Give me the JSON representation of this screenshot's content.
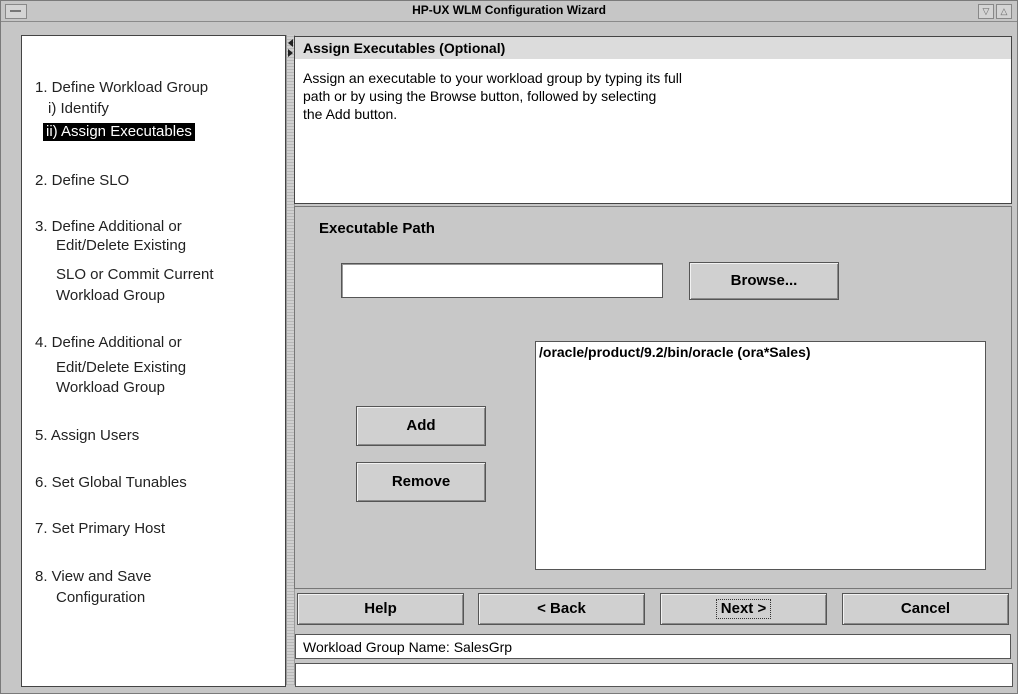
{
  "window": {
    "title": "HP-UX WLM Configuration Wizard"
  },
  "steps": [
    {
      "label": "1. Define Workload Group"
    },
    {
      "label": "2. Define SLO"
    },
    {
      "label": "3. Define Additional or"
    },
    {
      "label": "Edit/Delete Existing"
    },
    {
      "label": "SLO or Commit Current"
    },
    {
      "label": "Workload Group"
    },
    {
      "label": "4. Define Additional or"
    },
    {
      "label": "Edit/Delete Existing"
    },
    {
      "label": "Workload Group"
    },
    {
      "label": "5. Assign Users"
    },
    {
      "label": "6. Set Global Tunables"
    },
    {
      "label": "7. Set Primary Host"
    },
    {
      "label": "8. View and Save"
    },
    {
      "label": "Configuration"
    }
  ],
  "substeps": {
    "identify": "i) Identify",
    "assign": "ii) Assign Executables"
  },
  "instructions": {
    "header": "Assign Executables (Optional)",
    "lines": [
      "Assign an executable to your workload group by typing its full",
      "path or by using the Browse button, followed by selecting",
      "the Add button."
    ]
  },
  "form": {
    "path_label": "Executable Path",
    "path_value": "",
    "browse": "Browse...",
    "add": "Add",
    "remove": "Remove",
    "list_items": [
      "/oracle/product/9.2/bin/oracle (ora*Sales)"
    ]
  },
  "nav": {
    "help": "Help",
    "back": "< Back",
    "next": "Next >",
    "cancel": "Cancel"
  },
  "status": {
    "group_name": "Workload Group Name: SalesGrp"
  }
}
